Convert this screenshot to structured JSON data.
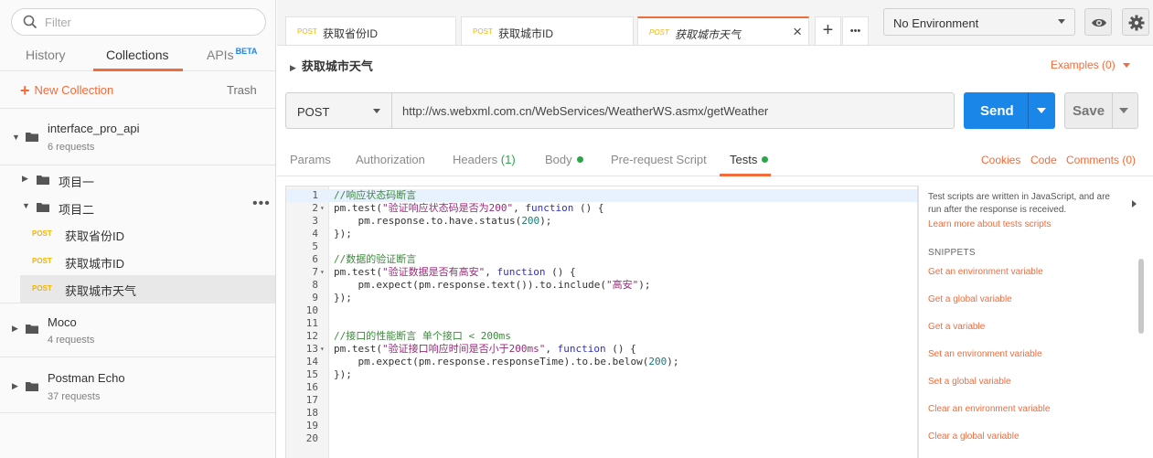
{
  "sidebar": {
    "filter_placeholder": "Filter",
    "tabs": {
      "history": "History",
      "collections": "Collections",
      "apis": "APIs",
      "apis_badge": "BETA"
    },
    "new_collection": "New Collection",
    "trash": "Trash",
    "collections": [
      {
        "name": "interface_pro_api",
        "requests": "6 requests"
      },
      {
        "name": "Moco",
        "requests": "4 requests"
      },
      {
        "name": "Postman Echo",
        "requests": "37 requests"
      }
    ],
    "folders": [
      {
        "name": "项目一"
      },
      {
        "name": "项目二"
      }
    ],
    "folder_menu": "•••",
    "requests": [
      {
        "method": "POST",
        "name": "获取省份ID"
      },
      {
        "method": "POST",
        "name": "获取城市ID"
      },
      {
        "method": "POST",
        "name": "获取城市天气"
      }
    ]
  },
  "tabs": [
    {
      "method": "POST",
      "name": "获取省份ID"
    },
    {
      "method": "POST",
      "name": "获取城市ID"
    },
    {
      "method": "POST",
      "name": "获取城市天气"
    }
  ],
  "tab_actions": {
    "close": "×",
    "add": "+",
    "more": "•••"
  },
  "environment": {
    "selected": "No Environment"
  },
  "request": {
    "title": "获取城市天气",
    "examples": "Examples (0)",
    "method": "POST",
    "url": "http://ws.webxml.com.cn/WebServices/WeatherWS.asmx/getWeather",
    "send": "Send",
    "save": "Save"
  },
  "subtabs": {
    "params": "Params",
    "authorization": "Authorization",
    "headers": "Headers",
    "headers_count": "(1)",
    "body": "Body",
    "prerequest": "Pre-request Script",
    "tests": "Tests",
    "cookies": "Cookies",
    "code": "Code",
    "comments": "Comments (0)"
  },
  "editor": {
    "lines": [
      {
        "n": "1",
        "fold": "",
        "parts": [
          {
            "t": "//响应状态码断言",
            "c": "c-cm"
          }
        ]
      },
      {
        "n": "2",
        "fold": "▾",
        "parts": [
          {
            "t": "pm.test(",
            "c": ""
          },
          {
            "t": "\"验证响应状态码是否为200\"",
            "c": "c-str"
          },
          {
            "t": ", ",
            "c": ""
          },
          {
            "t": "function",
            "c": "c-kw"
          },
          {
            "t": " () {",
            "c": ""
          }
        ]
      },
      {
        "n": "3",
        "fold": "",
        "parts": [
          {
            "t": "    pm.response.to.have.status(",
            "c": ""
          },
          {
            "t": "200",
            "c": "c-num"
          },
          {
            "t": ");",
            "c": ""
          }
        ]
      },
      {
        "n": "4",
        "fold": "",
        "parts": [
          {
            "t": "});",
            "c": ""
          }
        ]
      },
      {
        "n": "5",
        "fold": "",
        "parts": [
          {
            "t": "",
            "c": ""
          }
        ]
      },
      {
        "n": "6",
        "fold": "",
        "parts": [
          {
            "t": "//数据的验证断言",
            "c": "c-cm"
          }
        ]
      },
      {
        "n": "7",
        "fold": "▾",
        "parts": [
          {
            "t": "pm.test(",
            "c": ""
          },
          {
            "t": "\"验证数据是否有高安\"",
            "c": "c-str"
          },
          {
            "t": ", ",
            "c": ""
          },
          {
            "t": "function",
            "c": "c-kw"
          },
          {
            "t": " () {",
            "c": ""
          }
        ]
      },
      {
        "n": "8",
        "fold": "",
        "parts": [
          {
            "t": "    pm.expect(pm.response.text()).to.include(",
            "c": ""
          },
          {
            "t": "\"高安\"",
            "c": "c-str"
          },
          {
            "t": ");",
            "c": ""
          }
        ]
      },
      {
        "n": "9",
        "fold": "",
        "parts": [
          {
            "t": "});",
            "c": ""
          }
        ]
      },
      {
        "n": "10",
        "fold": "",
        "parts": [
          {
            "t": "",
            "c": ""
          }
        ]
      },
      {
        "n": "11",
        "fold": "",
        "parts": [
          {
            "t": "",
            "c": ""
          }
        ]
      },
      {
        "n": "12",
        "fold": "",
        "parts": [
          {
            "t": "//接口的性能断言 单个接口 < 200ms",
            "c": "c-cm"
          }
        ]
      },
      {
        "n": "13",
        "fold": "▾",
        "parts": [
          {
            "t": "pm.test(",
            "c": ""
          },
          {
            "t": "\"验证接口响应时间是否小于200ms\"",
            "c": "c-str"
          },
          {
            "t": ", ",
            "c": ""
          },
          {
            "t": "function",
            "c": "c-kw"
          },
          {
            "t": " () {",
            "c": ""
          }
        ]
      },
      {
        "n": "14",
        "fold": "",
        "parts": [
          {
            "t": "    pm.expect(pm.response.responseTime).to.be.below(",
            "c": ""
          },
          {
            "t": "200",
            "c": "c-num"
          },
          {
            "t": ");",
            "c": ""
          }
        ]
      },
      {
        "n": "15",
        "fold": "",
        "parts": [
          {
            "t": "});",
            "c": ""
          }
        ]
      },
      {
        "n": "16",
        "fold": "",
        "parts": [
          {
            "t": "",
            "c": ""
          }
        ]
      },
      {
        "n": "17",
        "fold": "",
        "parts": [
          {
            "t": "",
            "c": ""
          }
        ]
      },
      {
        "n": "18",
        "fold": "",
        "parts": [
          {
            "t": "",
            "c": ""
          }
        ]
      },
      {
        "n": "19",
        "fold": "",
        "parts": [
          {
            "t": "",
            "c": ""
          }
        ]
      },
      {
        "n": "20",
        "fold": "",
        "parts": [
          {
            "t": "",
            "c": ""
          }
        ]
      }
    ]
  },
  "help": {
    "description": "Test scripts are written in JavaScript, and are run after the response is received.",
    "learn_more": "Learn more about tests scripts",
    "snippets_title": "SNIPPETS",
    "snippets": [
      "Get an environment variable",
      "Get a global variable",
      "Get a variable",
      "Set an environment variable",
      "Set a global variable",
      "Clear an environment variable",
      "Clear a global variable"
    ]
  },
  "colors": {
    "accent": "#f26b3a",
    "primary": "#1a86e7",
    "method_post": "#f4b400",
    "status_ok": "#2aa54a"
  }
}
